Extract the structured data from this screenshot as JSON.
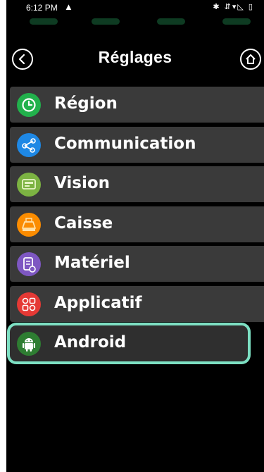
{
  "status": {
    "time": "6:12 PM",
    "warn_icon": "warning-icon",
    "right_icons": "✱ ⇵▾◺ ▯"
  },
  "header": {
    "title": "Réglages",
    "back_icon": "chevron-left-icon",
    "home_icon": "home-icon"
  },
  "menu": {
    "items": [
      {
        "label": "Région",
        "icon": "clock-icon",
        "color": "#22b14c"
      },
      {
        "label": "Communication",
        "icon": "share-icon",
        "color": "#1e88e5"
      },
      {
        "label": "Vision",
        "icon": "display-icon",
        "color": "#7cb342"
      },
      {
        "label": "Caisse",
        "icon": "register-icon",
        "color": "#fb8c00"
      },
      {
        "label": "Matériel",
        "icon": "hardware-icon",
        "color": "#7e57c2"
      },
      {
        "label": "Applicatif",
        "icon": "apps-icon",
        "color": "#e53935"
      },
      {
        "label": "Android",
        "icon": "android-icon",
        "color": "#2e7d32"
      }
    ],
    "selected_index": 6,
    "highlight_color": "#7de0c3"
  }
}
